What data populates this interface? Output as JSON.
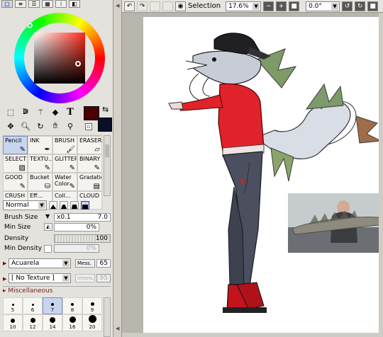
{
  "left_panel": {
    "top_icons": [
      "square-icon",
      "bars-icon",
      "lines-icon",
      "grid-icon",
      "dots-icon",
      "eraser-small-icon"
    ],
    "colors": {
      "foreground": "#4a0000",
      "background": "#0a0f28"
    },
    "tools": [
      "rect-select-icon",
      "lasso-icon",
      "magic-wand-icon",
      "shape-icon",
      "text-T",
      "move-icon",
      "zoom-icon",
      "rotate-icon",
      "hand-icon",
      "eyedropper-icon"
    ],
    "text_tool_label": "T",
    "brushes": [
      {
        "label": "Pencil",
        "selected": true
      },
      {
        "label": "INK"
      },
      {
        "label": "BRUSH"
      },
      {
        "label": "ERASER"
      },
      {
        "label": "SELECT"
      },
      {
        "label": "TEXTU..."
      },
      {
        "label": "GLITTER"
      },
      {
        "label": "BINARY"
      },
      {
        "label": "GOOD"
      },
      {
        "label": "Bucket"
      },
      {
        "label": "Water Color"
      },
      {
        "label": "Gradation"
      },
      {
        "label": "CRUSH"
      },
      {
        "label": "Eff..."
      },
      {
        "label": "Coll..."
      },
      {
        "label": "CLOUD"
      }
    ],
    "blend_mode": "Normal",
    "properties": {
      "brush_size_label": "Brush Size",
      "brush_size_mult": "x0.1",
      "brush_size_value": "7.0",
      "min_size_label": "Min Size",
      "min_size_value": "0%",
      "density_label": "Density",
      "density_value": "100",
      "min_density_label": "Min Density",
      "min_density_value": "0%"
    },
    "paper": {
      "name": "Acuarela",
      "mess_label": "Mess.",
      "mess_value": "65"
    },
    "texture": {
      "name": "[ No Texture ]",
      "intens_label": "Intens.",
      "intens_value": "95"
    },
    "misc_label": "Miscellaneous",
    "dot_sizes": [
      "5",
      "6",
      "7",
      "8",
      "9",
      "10",
      "12",
      "14",
      "16",
      "20"
    ],
    "selected_dot": "7"
  },
  "toolbar": {
    "selection_label": "Selection",
    "zoom": "17.6%",
    "rotation": "0.0°"
  },
  "canvas": {
    "paper_color": "#ffffff"
  }
}
